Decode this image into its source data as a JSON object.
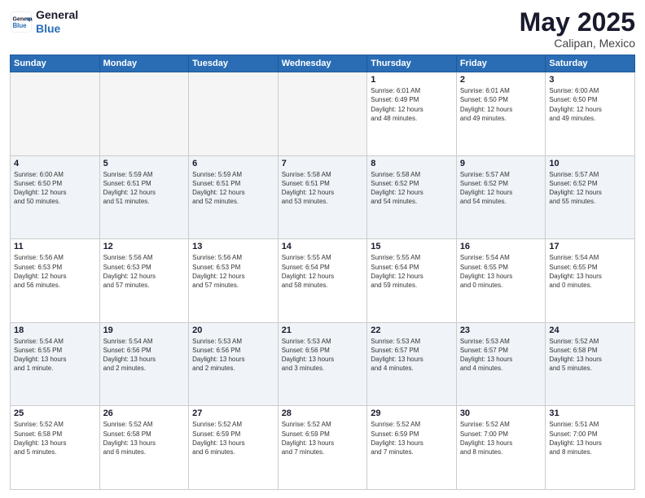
{
  "header": {
    "logo_line1": "General",
    "logo_line2": "Blue",
    "main_title": "May 2025",
    "subtitle": "Calipan, Mexico"
  },
  "days_of_week": [
    "Sunday",
    "Monday",
    "Tuesday",
    "Wednesday",
    "Thursday",
    "Friday",
    "Saturday"
  ],
  "weeks": [
    [
      {
        "day": "",
        "info": "",
        "empty": true
      },
      {
        "day": "",
        "info": "",
        "empty": true
      },
      {
        "day": "",
        "info": "",
        "empty": true
      },
      {
        "day": "",
        "info": "",
        "empty": true
      },
      {
        "day": "1",
        "info": "Sunrise: 6:01 AM\nSunset: 6:49 PM\nDaylight: 12 hours\nand 48 minutes."
      },
      {
        "day": "2",
        "info": "Sunrise: 6:01 AM\nSunset: 6:50 PM\nDaylight: 12 hours\nand 49 minutes."
      },
      {
        "day": "3",
        "info": "Sunrise: 6:00 AM\nSunset: 6:50 PM\nDaylight: 12 hours\nand 49 minutes."
      }
    ],
    [
      {
        "day": "4",
        "info": "Sunrise: 6:00 AM\nSunset: 6:50 PM\nDaylight: 12 hours\nand 50 minutes."
      },
      {
        "day": "5",
        "info": "Sunrise: 5:59 AM\nSunset: 6:51 PM\nDaylight: 12 hours\nand 51 minutes."
      },
      {
        "day": "6",
        "info": "Sunrise: 5:59 AM\nSunset: 6:51 PM\nDaylight: 12 hours\nand 52 minutes."
      },
      {
        "day": "7",
        "info": "Sunrise: 5:58 AM\nSunset: 6:51 PM\nDaylight: 12 hours\nand 53 minutes."
      },
      {
        "day": "8",
        "info": "Sunrise: 5:58 AM\nSunset: 6:52 PM\nDaylight: 12 hours\nand 54 minutes."
      },
      {
        "day": "9",
        "info": "Sunrise: 5:57 AM\nSunset: 6:52 PM\nDaylight: 12 hours\nand 54 minutes."
      },
      {
        "day": "10",
        "info": "Sunrise: 5:57 AM\nSunset: 6:52 PM\nDaylight: 12 hours\nand 55 minutes."
      }
    ],
    [
      {
        "day": "11",
        "info": "Sunrise: 5:56 AM\nSunset: 6:53 PM\nDaylight: 12 hours\nand 56 minutes."
      },
      {
        "day": "12",
        "info": "Sunrise: 5:56 AM\nSunset: 6:53 PM\nDaylight: 12 hours\nand 57 minutes."
      },
      {
        "day": "13",
        "info": "Sunrise: 5:56 AM\nSunset: 6:53 PM\nDaylight: 12 hours\nand 57 minutes."
      },
      {
        "day": "14",
        "info": "Sunrise: 5:55 AM\nSunset: 6:54 PM\nDaylight: 12 hours\nand 58 minutes."
      },
      {
        "day": "15",
        "info": "Sunrise: 5:55 AM\nSunset: 6:54 PM\nDaylight: 12 hours\nand 59 minutes."
      },
      {
        "day": "16",
        "info": "Sunrise: 5:54 AM\nSunset: 6:55 PM\nDaylight: 13 hours\nand 0 minutes."
      },
      {
        "day": "17",
        "info": "Sunrise: 5:54 AM\nSunset: 6:55 PM\nDaylight: 13 hours\nand 0 minutes."
      }
    ],
    [
      {
        "day": "18",
        "info": "Sunrise: 5:54 AM\nSunset: 6:55 PM\nDaylight: 13 hours\nand 1 minute."
      },
      {
        "day": "19",
        "info": "Sunrise: 5:54 AM\nSunset: 6:56 PM\nDaylight: 13 hours\nand 2 minutes."
      },
      {
        "day": "20",
        "info": "Sunrise: 5:53 AM\nSunset: 6:56 PM\nDaylight: 13 hours\nand 2 minutes."
      },
      {
        "day": "21",
        "info": "Sunrise: 5:53 AM\nSunset: 6:56 PM\nDaylight: 13 hours\nand 3 minutes."
      },
      {
        "day": "22",
        "info": "Sunrise: 5:53 AM\nSunset: 6:57 PM\nDaylight: 13 hours\nand 4 minutes."
      },
      {
        "day": "23",
        "info": "Sunrise: 5:53 AM\nSunset: 6:57 PM\nDaylight: 13 hours\nand 4 minutes."
      },
      {
        "day": "24",
        "info": "Sunrise: 5:52 AM\nSunset: 6:58 PM\nDaylight: 13 hours\nand 5 minutes."
      }
    ],
    [
      {
        "day": "25",
        "info": "Sunrise: 5:52 AM\nSunset: 6:58 PM\nDaylight: 13 hours\nand 5 minutes."
      },
      {
        "day": "26",
        "info": "Sunrise: 5:52 AM\nSunset: 6:58 PM\nDaylight: 13 hours\nand 6 minutes."
      },
      {
        "day": "27",
        "info": "Sunrise: 5:52 AM\nSunset: 6:59 PM\nDaylight: 13 hours\nand 6 minutes."
      },
      {
        "day": "28",
        "info": "Sunrise: 5:52 AM\nSunset: 6:59 PM\nDaylight: 13 hours\nand 7 minutes."
      },
      {
        "day": "29",
        "info": "Sunrise: 5:52 AM\nSunset: 6:59 PM\nDaylight: 13 hours\nand 7 minutes."
      },
      {
        "day": "30",
        "info": "Sunrise: 5:52 AM\nSunset: 7:00 PM\nDaylight: 13 hours\nand 8 minutes."
      },
      {
        "day": "31",
        "info": "Sunrise: 5:51 AM\nSunset: 7:00 PM\nDaylight: 13 hours\nand 8 minutes."
      }
    ]
  ],
  "alt_rows": [
    1,
    3
  ]
}
